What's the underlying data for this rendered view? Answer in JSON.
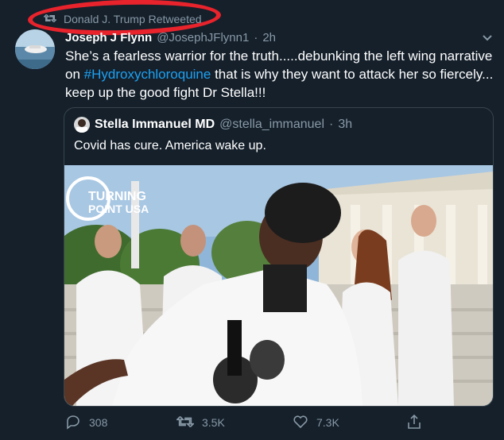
{
  "retweet": {
    "label": "Donald J. Trump Retweeted"
  },
  "tweet": {
    "author_name": "Joseph J Flynn",
    "handle": "@JosephJFlynn1",
    "separator": "·",
    "time": "2h",
    "text_part1": "She’s a fearless warrior for the truth.....debunking the left wing narrative on ",
    "hashtag": "#Hydroxychloroquine",
    "text_part2": " that is why they want to attack her so fiercely... keep up the good fight Dr Stella!!!"
  },
  "quote": {
    "author_name": "Stella Immanuel MD",
    "handle": "@stella_immanuel",
    "separator": "·",
    "time": "3h",
    "text": "Covid has cure. America wake up.",
    "watermark_line1": "TURNING",
    "watermark_line2": "POINT USA"
  },
  "actions": {
    "reply_count": "308",
    "retweet_count": "3.5K",
    "like_count": "7.3K"
  },
  "colors": {
    "background": "#15202b",
    "muted": "#8899a6",
    "link": "#1da1f2",
    "annotation_red": "#e8232c"
  }
}
